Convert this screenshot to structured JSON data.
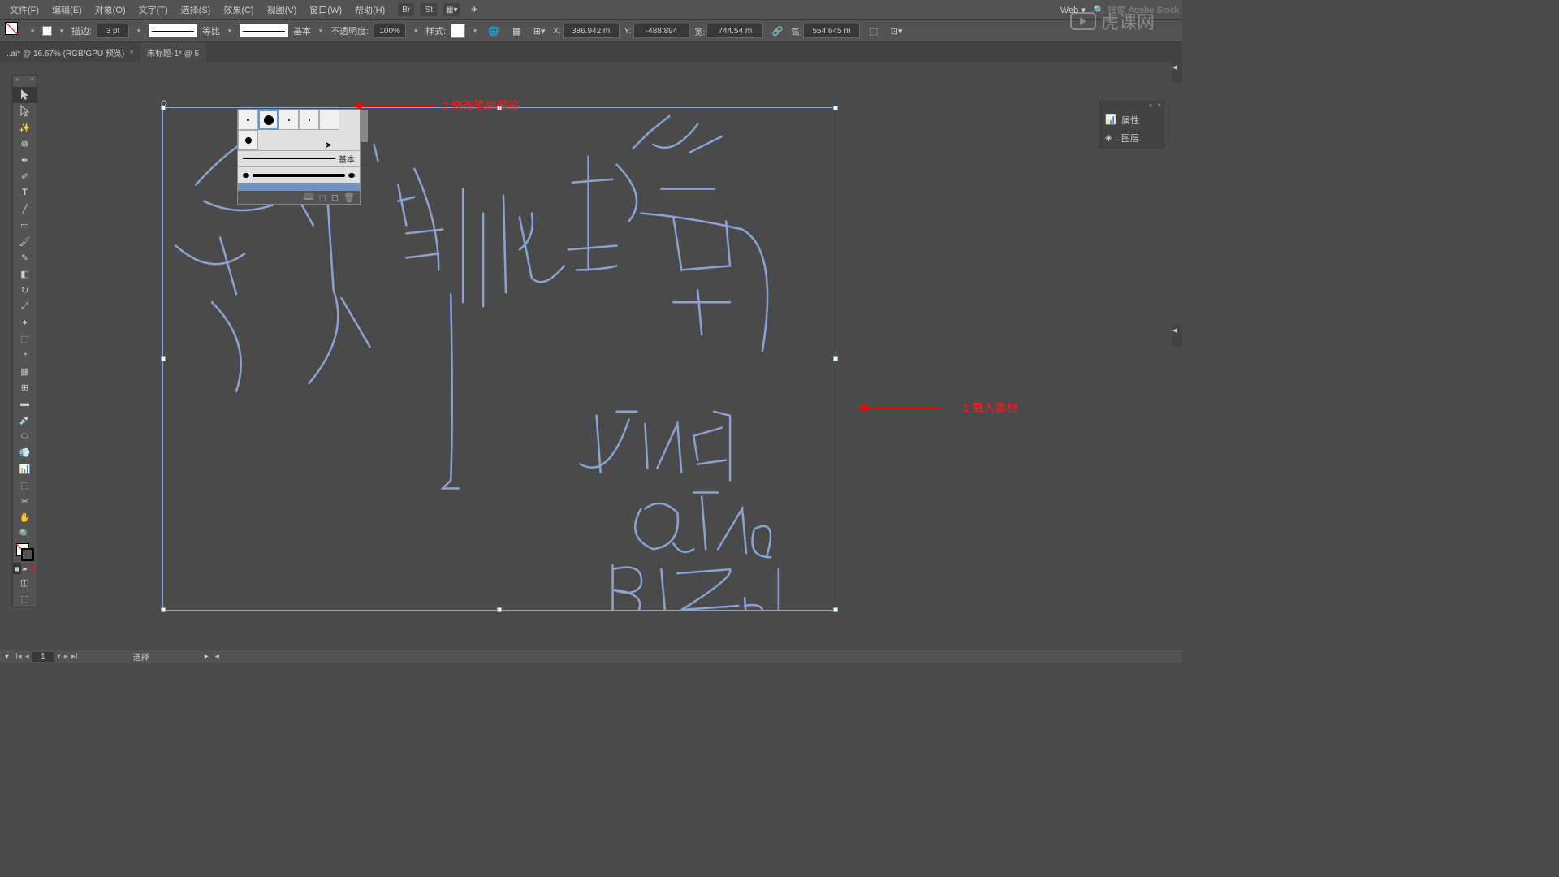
{
  "menu": {
    "file": "文件(F)",
    "edit": "编辑(E)",
    "object": "对象(O)",
    "text": "文字(T)",
    "select": "选择(S)",
    "effect": "效果(C)",
    "view": "视图(V)",
    "window": "窗口(W)",
    "help": "帮助(H)",
    "br": "Br",
    "st": "St"
  },
  "header": {
    "workspace": "Web",
    "search_placeholder": "搜索 Adobe Stock"
  },
  "control": {
    "stroke_l": "描边:",
    "stroke_v": "3 pt",
    "prof1": "等比",
    "prof2": "基本",
    "opacity_l": "不透明度:",
    "opacity_v": "100%",
    "style_l": "样式:",
    "x_l": "X:",
    "x_v": "386.942 m",
    "y_l": "Y:",
    "y_v": "-488.894",
    "w_l": "宽:",
    "w_v": "744.54 m",
    "h_l": "高:",
    "h_v": "554.645 m"
  },
  "tabs": {
    "t1": "..ai* @ 16.67% (RGB/GPU 预览)",
    "t2": "未标题-1* @ 5"
  },
  "brushpanel": {
    "basic": "基本"
  },
  "annotations": {
    "a1": "1 载入素材",
    "a2": "2 修改笔刷预设"
  },
  "rightpanel": {
    "prop": "属性",
    "layers": "图层"
  },
  "status": {
    "page": "1",
    "sel": "选择"
  },
  "watermark": "虎课网",
  "art_ref": "o"
}
